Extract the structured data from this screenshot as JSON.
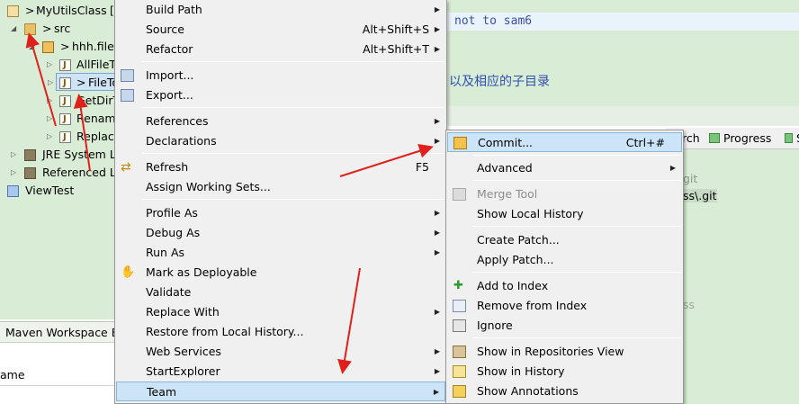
{
  "explorer": {
    "project": "MyUtilsClass",
    "project_suffix": "[",
    "src": "src",
    "package": "hhh.file",
    "files": [
      "AllFileT",
      "FileTo",
      "GetDirT",
      "Renam",
      "Replac"
    ],
    "jre": "JRE System Li",
    "referenced": "Referenced Li",
    "viewtest": "ViewTest",
    "decorator": ">"
  },
  "maven": {
    "title": "Maven Workspace B",
    "column": "ame"
  },
  "editor": {
    "code_line": "not to sam6",
    "chinese_text": "以及相应的子目录"
  },
  "view_tabs": {
    "search_partial": "rch",
    "progress": "Progress",
    "partial": "S"
  },
  "console": {
    "line1": "git",
    "line2": "ss\\.git",
    "line3": "ss"
  },
  "main_menu": {
    "items": [
      {
        "label": "Build Path",
        "accel": "",
        "submenu": true
      },
      {
        "label": "Source",
        "accel": "Alt+Shift+S",
        "submenu": true
      },
      {
        "label": "Refactor",
        "accel": "Alt+Shift+T",
        "submenu": true
      },
      {
        "label": "Import...",
        "accel": "",
        "submenu": false
      },
      {
        "label": "Export...",
        "accel": "",
        "submenu": false
      },
      {
        "label": "References",
        "accel": "",
        "submenu": true
      },
      {
        "label": "Declarations",
        "accel": "",
        "submenu": true
      },
      {
        "label": "Refresh",
        "accel": "F5",
        "submenu": false
      },
      {
        "label": "Assign Working Sets...",
        "accel": "",
        "submenu": false
      },
      {
        "label": "Profile As",
        "accel": "",
        "submenu": true
      },
      {
        "label": "Debug As",
        "accel": "",
        "submenu": true
      },
      {
        "label": "Run As",
        "accel": "",
        "submenu": true
      },
      {
        "label": "Mark as Deployable",
        "accel": "",
        "submenu": false
      },
      {
        "label": "Validate",
        "accel": "",
        "submenu": false
      },
      {
        "label": "Replace With",
        "accel": "",
        "submenu": true
      },
      {
        "label": "Restore from Local History...",
        "accel": "",
        "submenu": false
      },
      {
        "label": "Web Services",
        "accel": "",
        "submenu": true
      },
      {
        "label": "StartExplorer",
        "accel": "",
        "submenu": true
      },
      {
        "label": "Team",
        "accel": "",
        "submenu": true
      }
    ]
  },
  "team_menu": {
    "items": [
      {
        "label": "Commit...",
        "accel": "Ctrl+#",
        "submenu": false
      },
      {
        "label": "Advanced",
        "accel": "",
        "submenu": true
      },
      {
        "label": "Merge Tool",
        "accel": "",
        "submenu": false
      },
      {
        "label": "Show Local History",
        "accel": "",
        "submenu": false
      },
      {
        "label": "Create Patch...",
        "accel": "",
        "submenu": false
      },
      {
        "label": "Apply Patch...",
        "accel": "",
        "submenu": false
      },
      {
        "label": "Add to Index",
        "accel": "",
        "submenu": false
      },
      {
        "label": "Remove from Index",
        "accel": "",
        "submenu": false
      },
      {
        "label": "Ignore",
        "accel": "",
        "submenu": false
      },
      {
        "label": "Show in Repositories View",
        "accel": "",
        "submenu": false
      },
      {
        "label": "Show in History",
        "accel": "",
        "submenu": false
      },
      {
        "label": "Show Annotations",
        "accel": "",
        "submenu": false
      }
    ]
  },
  "colors": {
    "highlight": "#cce4f7",
    "annotation_arrow": "#e0201a",
    "explorer_bg": "#d9ecd6"
  }
}
